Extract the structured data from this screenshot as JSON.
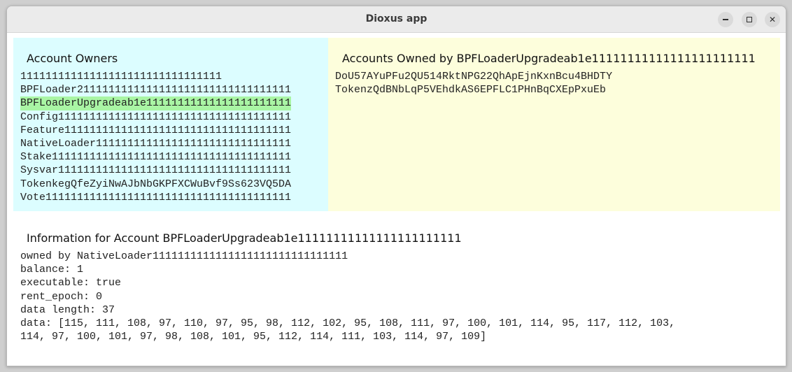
{
  "window": {
    "title": "Dioxus app"
  },
  "owners_panel": {
    "heading": "Account Owners",
    "items": [
      "11111111111111111111111111111111",
      "BPFLoader2111111111111111111111111111111111",
      "BPFLoaderUpgradeab1e11111111111111111111111",
      "Config1111111111111111111111111111111111111",
      "Feature111111111111111111111111111111111111",
      "NativeLoader1111111111111111111111111111111",
      "Stake11111111111111111111111111111111111111",
      "Sysvar1111111111111111111111111111111111111",
      "TokenkegQfeZyiNwAJbNbGKPFXCWuBvf9Ss623VQ5DA",
      "Vote111111111111111111111111111111111111111"
    ],
    "selected_index": 2,
    "background": "#dcfdff",
    "selected_color": "#a9f5a4"
  },
  "owned_panel": {
    "heading": "Accounts Owned by BPFLoaderUpgradeab1e11111111111111111111111",
    "items": [
      "DoU57AYuPFu2QU514RktNPG22QhApEjnKxnBcu4BHDTY",
      "TokenzQdBNbLqP5VEhdkAS6EPFLC1PHnBqCXEpPxuEb"
    ],
    "background": "#fdfedc"
  },
  "info_panel": {
    "heading": "Information for Account BPFLoaderUpgradeab1e11111111111111111111111",
    "lines": [
      "owned by NativeLoader1111111111111111111111111111111",
      "balance: 1",
      "executable: true",
      "rent_epoch: 0",
      "data length: 37",
      "data: [115, 111, 108, 97, 110, 97, 95, 98, 112, 102, 95, 108, 111, 97, 100, 101, 114, 95, 117, 112, 103,",
      "114, 97, 100, 101, 97, 98, 108, 101, 95, 112, 114, 111, 103, 114, 97, 109]"
    ]
  }
}
